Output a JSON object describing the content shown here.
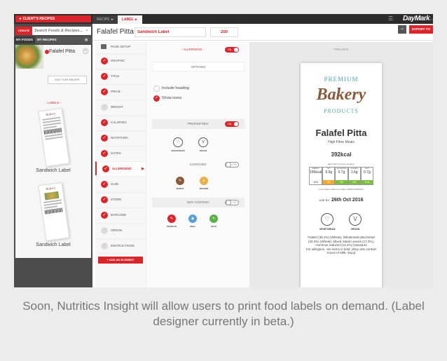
{
  "topbar": {
    "client_button": "◄ CLIENT'S RECIPES",
    "tabs": [
      "RECIPE ►",
      "LABEL ►"
    ],
    "logo": "DayMark",
    "logo_sub": "MENU STATION"
  },
  "left": {
    "create_label": "CREATE",
    "search_placeholder": "Search Foods & Recipes...",
    "lib_tabs": [
      "MY FOODS",
      "MY RECIPES"
    ],
    "recipe_title": "Falafel Pitta",
    "edit_button": "EDIT THIS RECIPE",
    "labels_heading": "- LABELS -",
    "labels": [
      {
        "caption": "Sandwich Label",
        "thumb_title": "Bakery"
      },
      {
        "caption": "Sandwich Label",
        "thumb_title": "Bakery"
      }
    ],
    "add_label_button": "+ ADD A LABEL"
  },
  "titlebar": {
    "recipe_name": "Falafel Pitta",
    "label_name": "Sandwich Label",
    "size_value": "200",
    "export_button": "EXPORT TO"
  },
  "elements": {
    "page_setup": "PAGE SETUP",
    "items": [
      {
        "label": "GRAPHIC",
        "on": true
      },
      {
        "label": "TITLE",
        "on": true
      },
      {
        "label": "PRICE",
        "on": true
      },
      {
        "label": "WEIGHT",
        "on": false
      },
      {
        "label": "CALORIES",
        "on": true
      },
      {
        "label": "NUTRITION",
        "on": true
      },
      {
        "label": "DATES",
        "on": true
      },
      {
        "label": "ALLERGENS",
        "on": true,
        "active": true
      },
      {
        "label": "GUID",
        "on": true
      },
      {
        "label": "STORE",
        "on": true
      },
      {
        "label": "BARCODE",
        "on": true
      },
      {
        "label": "ORIGIN",
        "on": false
      },
      {
        "label": "INSTRUCTIONS",
        "on": false
      }
    ],
    "add_element_button": "+ ADD AN ELEMENT"
  },
  "props": {
    "section_title": "- ALLERGENS -",
    "section_toggle": "ON",
    "options_band": "OPTIONS",
    "include_heading": "Include heading",
    "show_icons": "Show icons",
    "properties_band": "PROPERTIES:",
    "properties_toggle": "ON",
    "diet": [
      "VEGETARIAN",
      "VEGAN"
    ],
    "contains_band": "CONTAINS:",
    "contains_toggle": "OFF",
    "contains": [
      "WHEAT",
      "SESAME"
    ],
    "may_contain_band": "MAY CONTAIN:",
    "may_contain_toggle": "OFF",
    "may_contain": [
      "PEANUTS",
      "MILK",
      "SOYA"
    ]
  },
  "preview": {
    "title": "- PREVIEW -",
    "premium": "PREMIUM",
    "bakery": "Bakery",
    "products": "PRODUCTS",
    "name": "Falafel Pitta",
    "sub": "High Fibre Meals",
    "kcal": "392kcal",
    "each": "Each 100 g portion contains:",
    "nutrition": [
      {
        "head": "ENERGY",
        "value": "195kcal",
        "pct": "10%",
        "color": "#ffffff"
      },
      {
        "head": "FAT",
        "value": "6.6g",
        "pct": "9%",
        "color": "#f5a623"
      },
      {
        "head": "SATURATES",
        "value": "0.7g",
        "pct": "4%",
        "color": "#7cbf3b"
      },
      {
        "head": "SUGARS",
        "value": "1.6g",
        "pct": "2%",
        "color": "#7cbf3b"
      },
      {
        "head": "SALT",
        "value": "0.7g",
        "pct": "11%",
        "color": "#7cbf3b"
      }
    ],
    "ref": "of an adult's reference intake (2000kcal/8400kJ)",
    "useby_prefix": "USE BY:",
    "useby_date": "26th Oct 2016",
    "diet": [
      "VEGETARIAN",
      "VEGAN"
    ],
    "ingredients": "Falafel (36.1%) (Wheat), Wholemeal pitta bread (32.2%) (Wheat), Mixed Salad Leaves (17.3%), Hummus reduced (14.4%) (Sesame)",
    "allergy_note": "For allergens, see items in bold. (May also contain traces of Milk, Soya)"
  },
  "caption": "Soon, Nutritics Insight will allow users to print food labels on demand. (Label designer currently in beta.)",
  "colors": {
    "accent": "#d9262c",
    "teal": "#4aa7b0",
    "brown": "#8a5a3a"
  },
  "icons": [
    "printer-icon",
    "check-icon",
    "vegetarian-icon",
    "vegan-icon",
    "wheat-icon",
    "sesame-icon",
    "peanuts-icon",
    "milk-icon",
    "soya-icon",
    "share-icon",
    "menu-icon"
  ]
}
